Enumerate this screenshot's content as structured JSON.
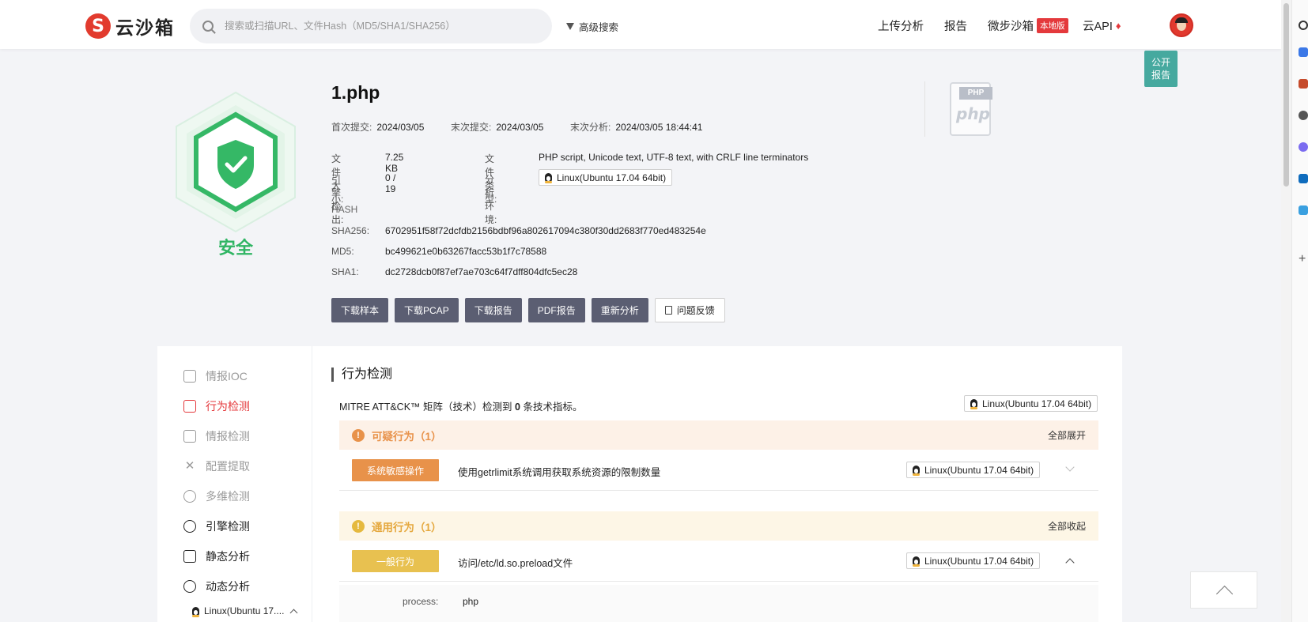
{
  "header": {
    "logo_mark": "S",
    "logo_text": "云沙箱",
    "search_placeholder": "搜索或扫描URL、文件Hash（MD5/SHA1/SHA256）",
    "advanced_search": "高级搜索",
    "nav": {
      "upload": "上传分析",
      "report": "报告",
      "micro_sandbox": "微步沙箱",
      "local_badge": "本地版",
      "cloud_api": "云API"
    }
  },
  "public_report": "公开\n报告",
  "verdict": "安全",
  "file": {
    "name": "1.php",
    "first_submit_label": "首次提交:",
    "first_submit": "2024/03/05",
    "last_submit_label": "末次提交:",
    "last_submit": "2024/03/05",
    "last_analysis_label": "末次分析:",
    "last_analysis": "2024/03/05 18:44:41",
    "size_label": "文件大小:",
    "size": "7.25 KB",
    "type_label": "文件类型:",
    "type": "PHP script, Unicode text, UTF-8 text, with CRLF line terminators",
    "engine_label": "引擎检出:",
    "engine": "0 / 19",
    "env_label": "分析环境:",
    "env": "Linux(Ubuntu 17.04 64bit)",
    "hash_heading": "HASH",
    "sha256_label": "SHA256:",
    "sha256": "6702951f58f72dcfdb2156bdbf96a802617094c380f30dd2683f770ed483254e",
    "md5_label": "MD5:",
    "md5": "bc499621e0b63267facc53b1f7c78588",
    "sha1_label": "SHA1:",
    "sha1": "dc2728dcb0f87ef7ae703c64f7dff804dfc5ec28",
    "icon_tag": "PHP",
    "icon_word": "php"
  },
  "actions": {
    "download_sample": "下载样本",
    "download_pcap": "下载PCAP",
    "download_report": "下载报告",
    "pdf_report": "PDF报告",
    "reanalyze": "重新分析",
    "feedback": "问题反馈"
  },
  "sidebar": {
    "items": [
      {
        "label": "情报IOC"
      },
      {
        "label": "行为检测"
      },
      {
        "label": "情报检测"
      },
      {
        "label": "配置提取"
      },
      {
        "label": "多维检测"
      },
      {
        "label": "引擎检测"
      },
      {
        "label": "静态分析"
      },
      {
        "label": "动态分析"
      }
    ],
    "sub_item": "Linux(Ubuntu 17...."
  },
  "behavior": {
    "title": "行为检测",
    "mitre_prefix": "MITRE ATT&CK™ 矩阵（技术）检测到",
    "mitre_count": "0",
    "mitre_suffix": "条技术指标。",
    "env": "Linux(Ubuntu 17.04 64bit)",
    "suspicious": {
      "label": "可疑行为（1）",
      "action": "全部展开",
      "color": "#e8924a",
      "rows": [
        {
          "tag": "系统敏感操作",
          "text": "使用getrlimit系统调用获取系统资源的限制数量",
          "env": "Linux(Ubuntu 17.04 64bit)"
        }
      ]
    },
    "general": {
      "label": "通用行为（1）",
      "action": "全部收起",
      "color": "#e5b93e",
      "rows": [
        {
          "tag": "一般行为",
          "text": "访问/etc/ld.so.preload文件",
          "env": "Linux(Ubuntu 17.04 64bit)"
        }
      ],
      "detail_key": "process:",
      "detail_value": "php"
    }
  },
  "colors": {
    "accent_red": "#e4393c",
    "safe_green": "#2fb563",
    "button_dark": "#5b5e72",
    "public_teal": "#46a99f"
  }
}
